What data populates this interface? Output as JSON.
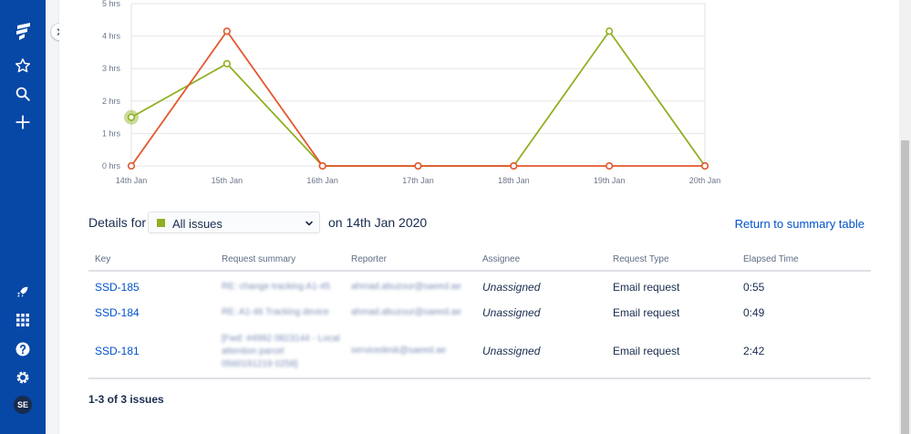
{
  "nav": {
    "icons": [
      "jira-logo-icon",
      "star-icon",
      "search-icon",
      "plus-icon",
      "rocket-icon",
      "app-grid-icon",
      "help-icon",
      "settings-icon"
    ],
    "avatar_initials": "SE"
  },
  "colors": {
    "sidebar": "#0747a6",
    "series_green": "#8fb021",
    "series_orange": "#e4572e",
    "link": "#0052cc"
  },
  "chart_data": {
    "type": "line",
    "x": [
      "14th Jan",
      "15th Jan",
      "16th Jan",
      "17th Jan",
      "18th Jan",
      "19th Jan",
      "20th Jan"
    ],
    "y_ticks": [
      "0 hrs",
      "1 hrs",
      "2 hrs",
      "3 hrs",
      "4 hrs",
      "5 hrs"
    ],
    "ylim": [
      0,
      5
    ],
    "series": [
      {
        "values": [
          1.5,
          3.15,
          0,
          0,
          0,
          4.15,
          0
        ],
        "color": "#8fb021"
      },
      {
        "values": [
          0,
          4.15,
          0,
          0,
          0,
          0,
          0
        ],
        "color": "#e4572e"
      }
    ],
    "highlighted_point": {
      "series": 0,
      "index": 0
    },
    "grid": true
  },
  "details": {
    "label": "Details for",
    "filter_value": "All issues",
    "date_text": "on 14th Jan 2020",
    "return_link": "Return to summary table"
  },
  "table": {
    "headers": [
      "Key",
      "Request summary",
      "Reporter",
      "Assignee",
      "Request Type",
      "Elapsed Time"
    ],
    "rows": [
      {
        "key": "SSD-185",
        "summary": [
          "RE: change tracking A1-45"
        ],
        "reporter": "ahmad.abuzour@saeed.ae",
        "assignee": "Unassigned",
        "type": "Email request",
        "elapsed": "0:55"
      },
      {
        "key": "SSD-184",
        "summary": [
          "RE: A1-46 Tracking device"
        ],
        "reporter": "ahmad.abuzour@saeed.ae",
        "assignee": "Unassigned",
        "type": "Email request",
        "elapsed": "0:49"
      },
      {
        "key": "SSD-181",
        "summary": [
          "[Fwd: #4992 0823144 - Local",
          "attention parcel",
          "0560191219 0258]"
        ],
        "reporter": "servicedesk@saeed.ae",
        "assignee": "Unassigned",
        "type": "Email request",
        "elapsed": "2:42"
      }
    ]
  },
  "footer": {
    "count_text": "1-3 of 3 issues"
  }
}
